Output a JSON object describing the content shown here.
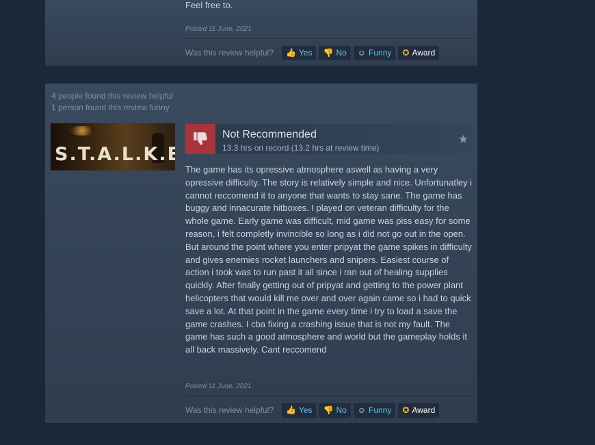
{
  "review1": {
    "tail_text": "Feel free to.",
    "posted": "Posted 11 June, 2021.",
    "helpful_label": "Was this review helpful?",
    "buttons": {
      "yes": "Yes",
      "no": "No",
      "funny": "Funny",
      "award": "Award"
    }
  },
  "review2": {
    "helpful_count": "4 people found this review helpful",
    "funny_count": "1 person found this review funny",
    "game_logo": "S.T.A.L.K.E.R.",
    "verdict": "Not Recommended",
    "hours": "13.3 hrs on record (13.2 hrs at review time)",
    "body": "The game has its opressive atmosphere aswell as having a very opressive difficulty. The story is relatively simple and nice. Unfortunatley i cannot reccomend it to anyone that wants to stay sane. The game has buggy and innacurate hitboxes. I played on veteran difficulty for the whole game. Early game was difficult, mid game was piss easy for some reason, i felt completly invincible so long as i did not go out in the open. But around the point where you enter pripyat the game spikes in difficulty and gives enemies rocket launchers and snipers. Easiest course of action i took was to run past it all since i ran out of healing supplies quickly. After finally getting out of pripyat and getting to the power plant helicopters that would kill me over and over again came so i had to quick save a lot. At that point in the game every time i try to load a save the game crashes. I cba fixing a crashing issue that is not my fault. The game has such a good atmosphere and world but the gameplay holds it all back massively. Cant reccomend",
    "posted": "Posted 11 June, 2021.",
    "helpful_label": "Was this review helpful?",
    "buttons": {
      "yes": "Yes",
      "no": "No",
      "funny": "Funny",
      "award": "Award"
    }
  },
  "icons": {
    "yes": "thumbs-up-icon",
    "no": "thumbs-down-icon",
    "funny": "smiley-icon",
    "award": "award-ribbon-icon",
    "verdict": "thumbs-down-icon",
    "favorite": "star-icon"
  },
  "colors": {
    "page_bg": "#1b2838",
    "card_bg": "#3a4a5e",
    "link_blue": "#66c0f4",
    "not_recommended_red": "#a8333a"
  }
}
